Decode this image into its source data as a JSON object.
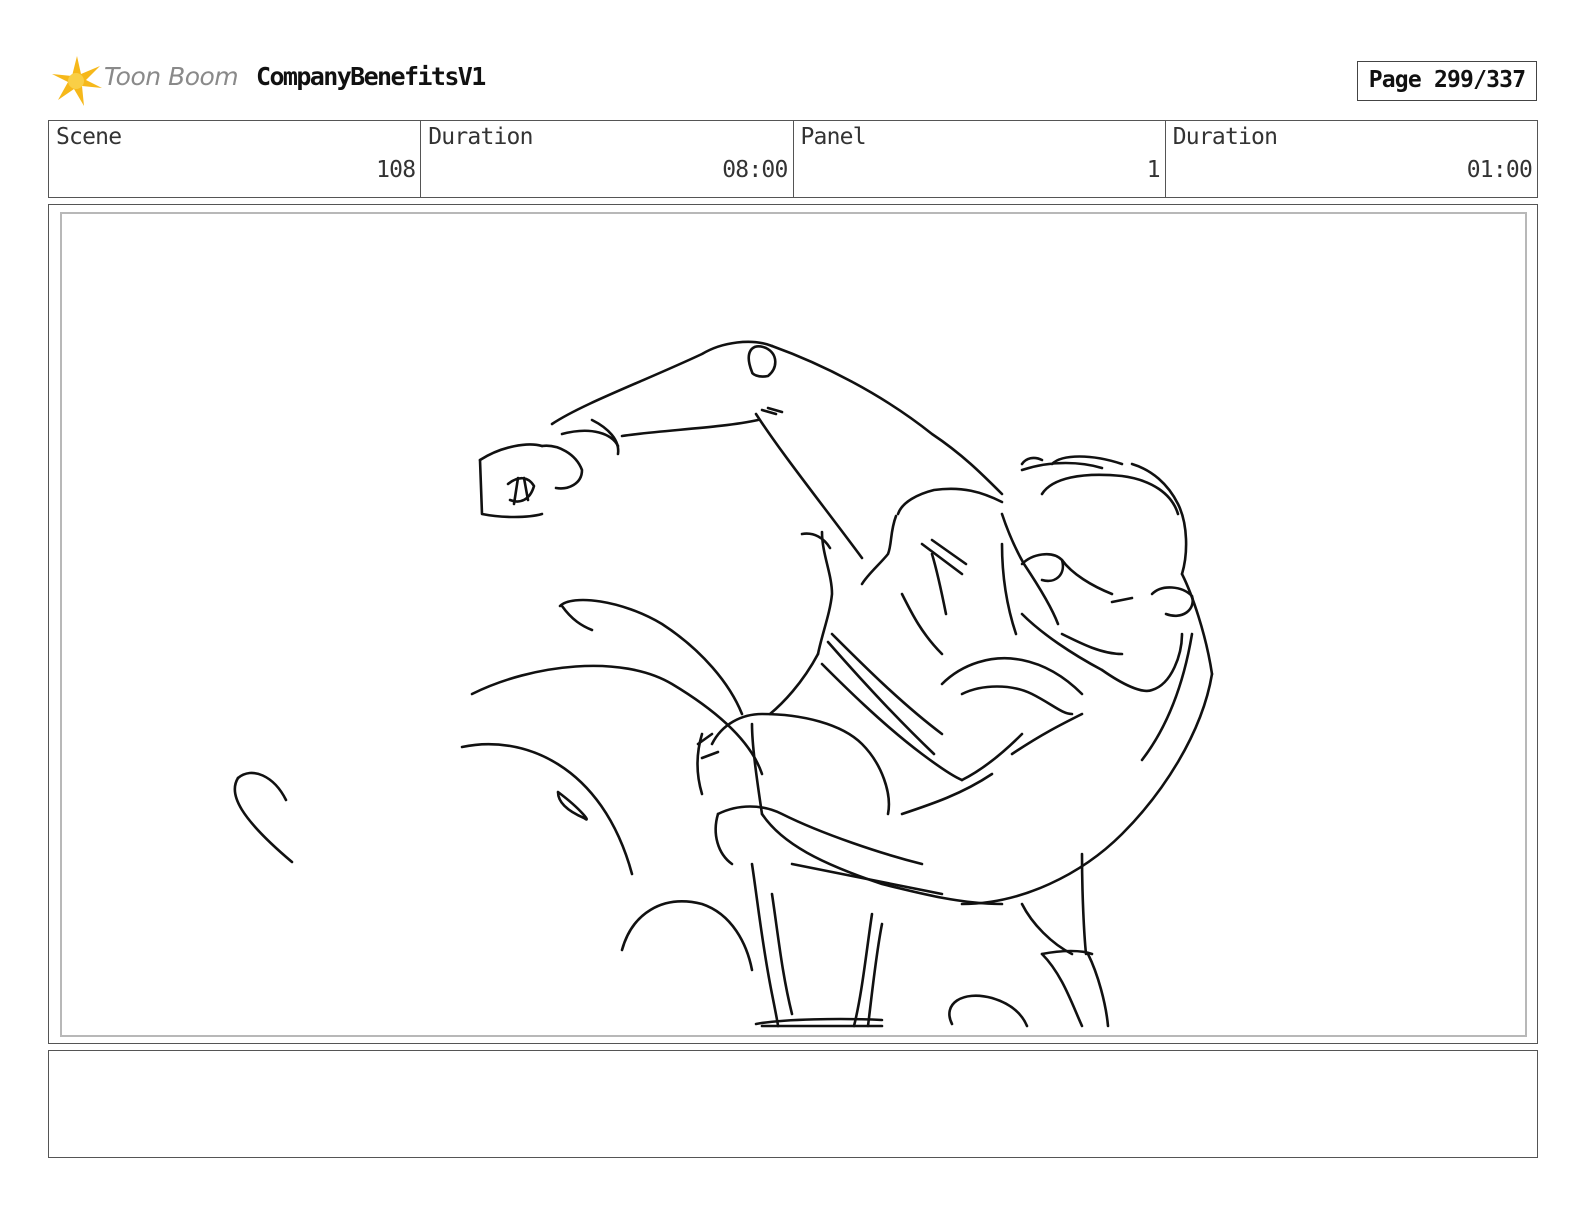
{
  "header": {
    "logo_text": "Toon Boom",
    "project_title": "CompanyBenefitsV1",
    "page_label": "Page 299/337"
  },
  "info": {
    "scene_label": "Scene",
    "scene_value": "108",
    "scene_duration_label": "Duration",
    "scene_duration_value": "08:00",
    "panel_label": "Panel",
    "panel_value": "1",
    "panel_duration_label": "Duration",
    "panel_duration_value": "01:00"
  },
  "panel": {
    "image_icon": "storyboard-sketch"
  },
  "notes": {
    "text": ""
  }
}
